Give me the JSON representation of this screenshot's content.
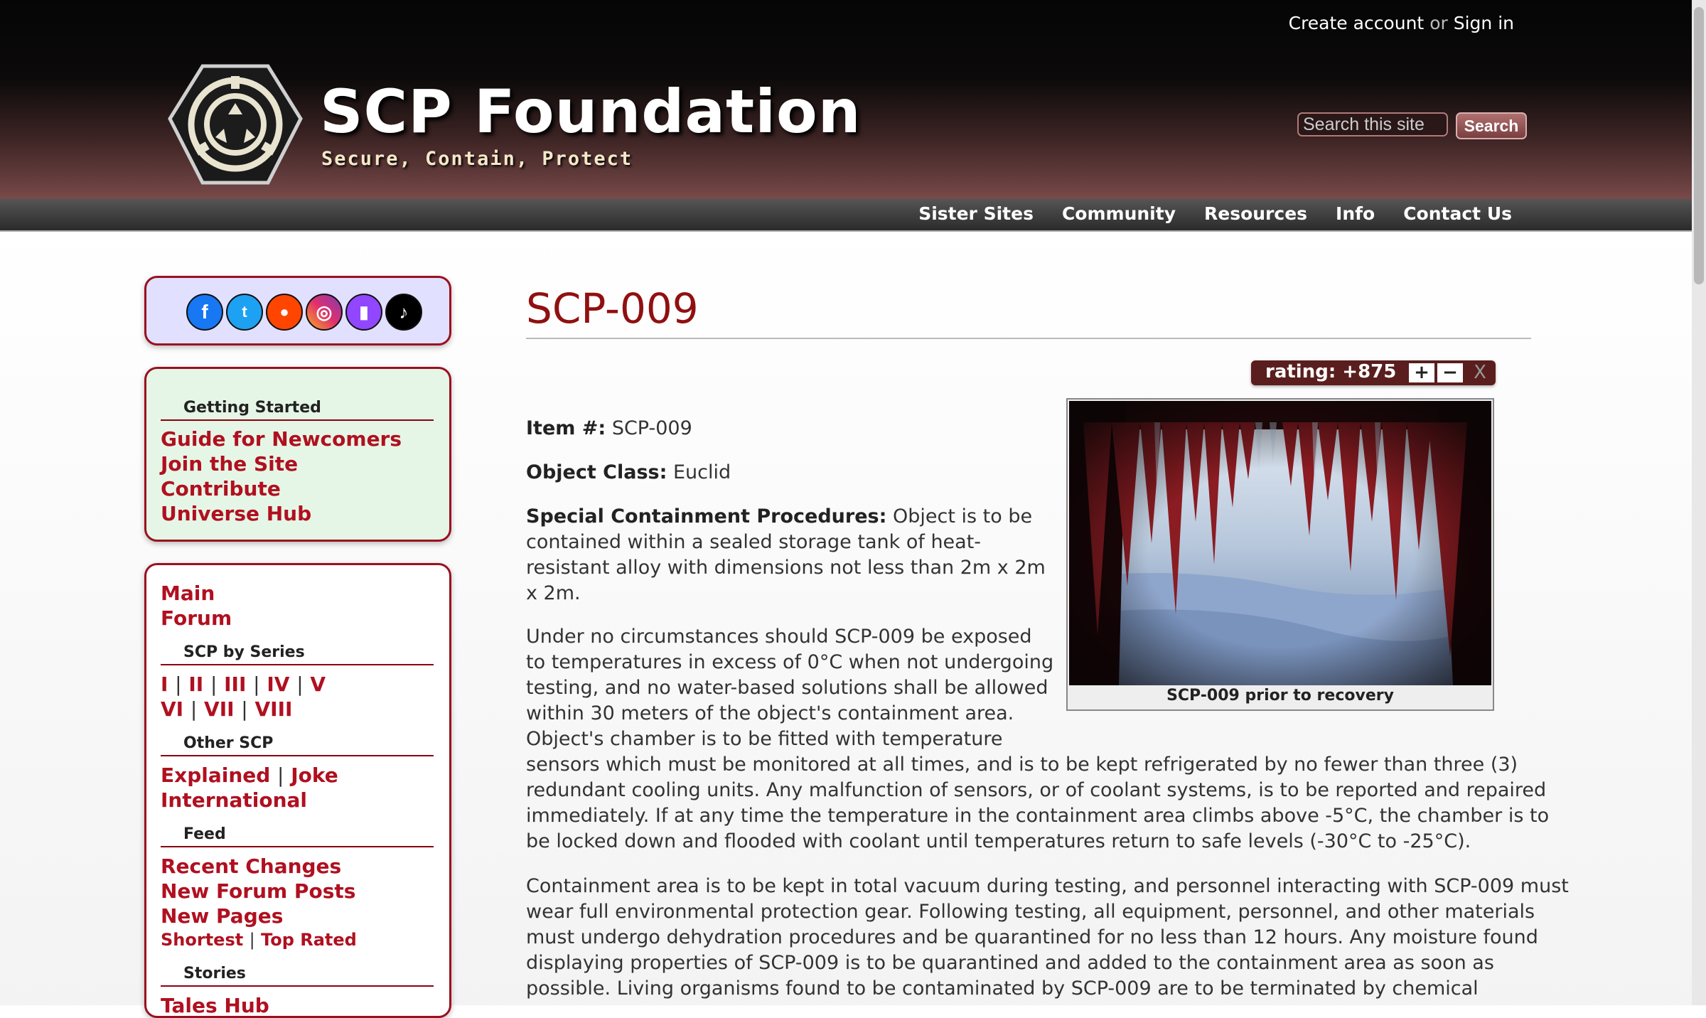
{
  "header": {
    "create_account": "Create account",
    "or": "or",
    "sign_in": "Sign in",
    "title": "SCP Foundation",
    "tagline": "Secure, Contain, Protect",
    "search_placeholder": "Search this site",
    "search_label": "Search"
  },
  "nav": {
    "items": [
      "Sister Sites",
      "Community",
      "Resources",
      "Info",
      "Contact Us"
    ]
  },
  "sidebar": {
    "social_icons": [
      "facebook-icon",
      "twitter-icon",
      "reddit-icon",
      "instagram-icon",
      "twitch-icon",
      "tiktok-icon"
    ],
    "getting_started": {
      "heading": "Getting Started",
      "links": [
        "Guide for Newcomers",
        "Join the Site",
        "Contribute",
        "Universe Hub"
      ]
    },
    "main_links": [
      "Main",
      "Forum"
    ],
    "scp_by_series": {
      "heading": "SCP by Series",
      "row1": [
        "I",
        "II",
        "III",
        "IV",
        "V"
      ],
      "row2": [
        "VI",
        "VII",
        "VIII"
      ]
    },
    "other_scp": {
      "heading": "Other SCP",
      "links": [
        "Explained",
        "Joke",
        "International"
      ]
    },
    "feed": {
      "heading": "Feed",
      "links": [
        "Recent Changes",
        "New Forum Posts",
        "New Pages"
      ],
      "small_links": [
        "Shortest",
        "Top Rated"
      ]
    },
    "stories": {
      "heading": "Stories",
      "links": [
        "Tales Hub"
      ]
    }
  },
  "article": {
    "title": "SCP-009",
    "rating_label": "rating: +875",
    "rating_plus": "+",
    "rating_minus": "−",
    "rating_close": "X",
    "image_caption": "SCP-009 prior to recovery",
    "item_label": "Item #:",
    "item_value": "SCP-009",
    "class_label": "Object Class:",
    "class_value": "Euclid",
    "scp_label": "Special Containment Procedures:",
    "scp_lines": [
      " Object is to be",
      "contained within a sealed storage tank of heat-",
      "resistant alloy with dimensions not less than 2m x 2m",
      "x 2m."
    ],
    "para2_lines": [
      "Under no circumstances should SCP-009 be exposed",
      "to temperatures in excess of 0°C when not undergoing",
      "testing, and no water-based solutions shall be allowed",
      "within 30 meters of the object's containment area.",
      "Object's chamber is to be fitted with temperature",
      "sensors which must be monitored at all times, and is to be kept refrigerated by no fewer than three (3)",
      "redundant cooling units. Any malfunction of sensors, or of coolant systems, is to be reported and repaired",
      "immediately. If at any time the temperature in the containment area climbs above -5°C, the chamber is to",
      "be locked down and flooded with coolant until temperatures return to safe levels (-30°C to -25°C)."
    ],
    "para3_lines": [
      "Containment area is to be kept in total vacuum during testing, and personnel interacting with SCP-009 must",
      "wear full environmental protection gear. Following testing, all equipment, personnel, and other materials",
      "must undergo dehydration procedures and be quarantined for no less than 12 hours. Any moisture found",
      "displaying properties of SCP-009 is to be quarantined and added to the containment area as soon as",
      "possible. Living organisms found to be contaminated by SCP-009 are to be terminated by chemical"
    ]
  },
  "colors": {
    "accent_red": "#b01020",
    "title_red": "#901010",
    "header_dark": "#050505",
    "header_maroon": "#7a4a4a"
  }
}
